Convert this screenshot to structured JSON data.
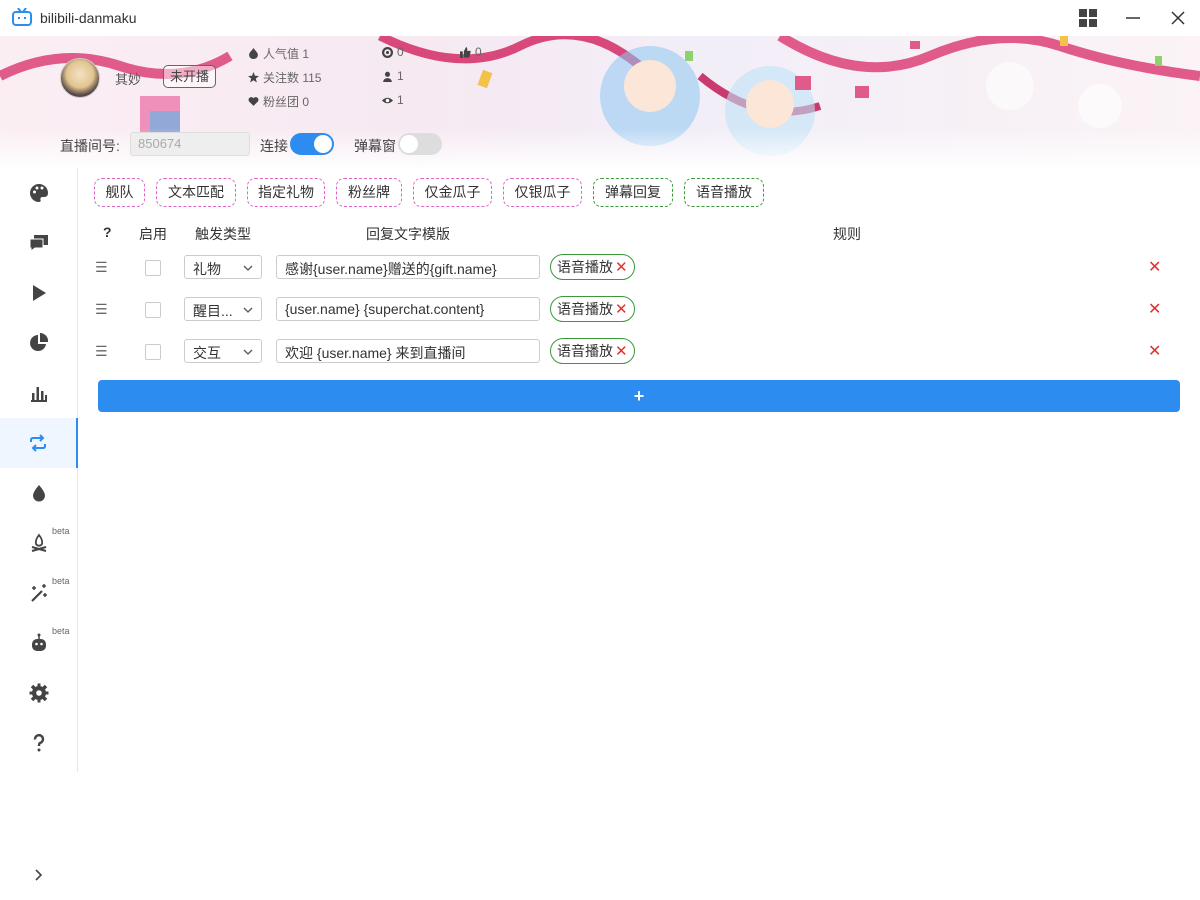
{
  "window": {
    "title": "bilibili-danmaku"
  },
  "header": {
    "username": "其妙",
    "live_status": "未开播",
    "stats": {
      "popularity": "人气值 1",
      "followers": "关注数 115",
      "fans_club": "粉丝团 0",
      "stat_a": "0",
      "stat_b": "1",
      "stat_c": "1",
      "likes": "0"
    },
    "room_label": "直播间号:",
    "room_id": "850674",
    "connect_label": "连接",
    "connect_on": true,
    "danmu_window_label": "弹幕窗",
    "danmu_window_on": false
  },
  "sidebar": {
    "items": [
      {
        "icon": "palette-icon",
        "beta": ""
      },
      {
        "icon": "chat-icon",
        "beta": ""
      },
      {
        "icon": "play-icon",
        "beta": ""
      },
      {
        "icon": "pie-chart-icon",
        "beta": ""
      },
      {
        "icon": "bar-chart-icon",
        "beta": ""
      },
      {
        "icon": "repeat-icon",
        "beta": "",
        "active": true
      },
      {
        "icon": "drop-icon",
        "beta": ""
      },
      {
        "icon": "campfire-icon",
        "beta": "beta"
      },
      {
        "icon": "magic-wand-icon",
        "beta": "beta"
      },
      {
        "icon": "robot-icon",
        "beta": "beta"
      },
      {
        "icon": "gear-icon",
        "beta": ""
      },
      {
        "icon": "help-icon",
        "beta": ""
      }
    ]
  },
  "filters": {
    "tags": [
      "舰队",
      "文本匹配",
      "指定礼物",
      "粉丝牌",
      "仅金瓜子",
      "仅银瓜子",
      "弹幕回复",
      "语音播放"
    ]
  },
  "table": {
    "headers": {
      "help": "?",
      "enabled": "启用",
      "trigger": "触发类型",
      "template": "回复文字模版",
      "rules": "规则"
    },
    "rows": [
      {
        "trigger": "礼物",
        "template": "感谢{user.name}赠送的{gift.name}",
        "rule": "语音播放",
        "rule_remove": "✕",
        "delete": "✕"
      },
      {
        "trigger": "醒目...",
        "template": "{user.name} {superchat.content}",
        "rule": "语音播放",
        "rule_remove": "✕",
        "delete": "✕"
      },
      {
        "trigger": "交互",
        "template": "欢迎 {user.name} 来到直播间",
        "rule": "语音播放",
        "rule_remove": "✕",
        "delete": "✕"
      }
    ],
    "add_label": "+"
  },
  "colors": {
    "accent": "#2d8cf0",
    "danger": "#e03030",
    "tag_pink": "#e064c8",
    "tag_green": "#3a9a3a"
  }
}
